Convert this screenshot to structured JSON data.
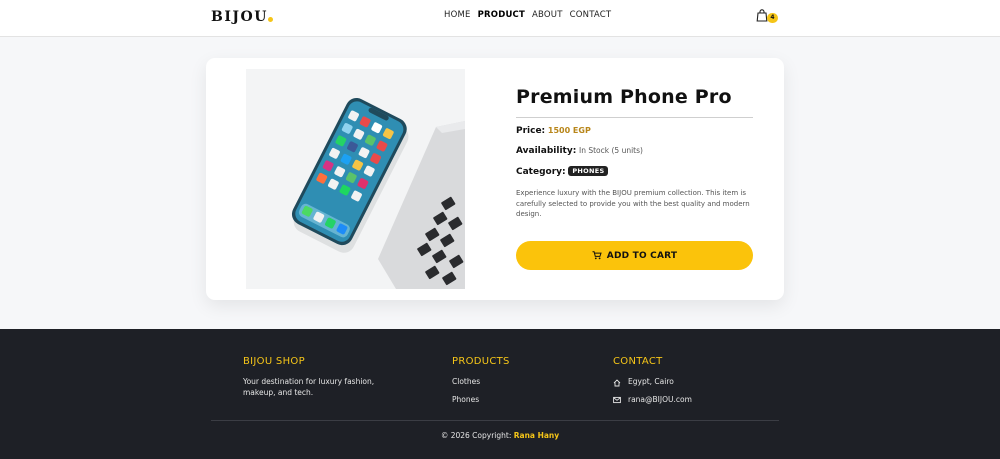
{
  "nav": {
    "brand": "BIJOU",
    "links": [
      "HOME",
      "PRODUCT",
      "ABOUT",
      "CONTACT"
    ],
    "active_link": "PRODUCT",
    "cart_count": "4"
  },
  "product": {
    "title": "Premium Phone Pro",
    "price_label": "Price:",
    "price_value": "1500 EGP",
    "availability_label": "Availability:",
    "availability_value": "In Stock (5 units)",
    "category_label": "Category:",
    "category_value": "PHONES",
    "description": "Experience luxury with the BIJOU premium collection. This item is carefully selected to provide you with the best quality and modern design.",
    "add_to_cart": "ADD TO CART"
  },
  "footer": {
    "col1_title": "BIJOU SHOP",
    "col1_text": "Your destination for luxury fashion, makeup, and tech.",
    "col2_title": "PRODUCTS",
    "col2_items": [
      "Clothes",
      "Phones"
    ],
    "col3_title": "CONTACT",
    "location": "Egypt, Cairo",
    "email": "rana@BIJOU.com",
    "copyright_prefix": "© 2026 Copyright:",
    "copyright_name": "Rana Hany"
  },
  "colors": {
    "accent": "#fbc30b",
    "footer_bg": "#1e2026",
    "price": "#b8861a"
  },
  "icons": [
    "shopping-bag-icon",
    "cart-icon",
    "home-icon",
    "envelope-icon"
  ]
}
